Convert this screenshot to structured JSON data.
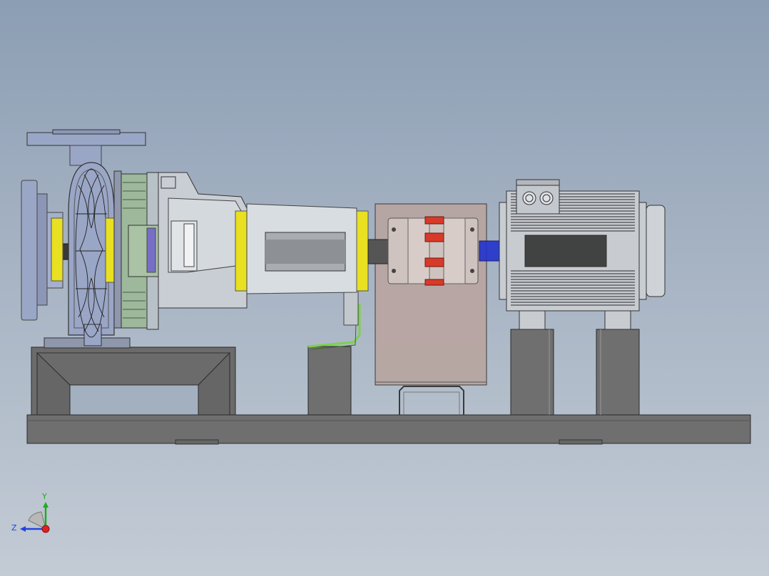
{
  "viewport": {
    "background_top": "#8c9eb4",
    "background_bottom": "#c3cbd5"
  },
  "model": {
    "components": [
      "pump-casing",
      "suction-flange",
      "discharge-flange",
      "impeller",
      "bearing-bracket",
      "pump-shaft",
      "coupling-guard",
      "jaw-coupling",
      "electric-motor",
      "motor-terminal-box",
      "motor-shaft",
      "motor-feet",
      "pump-support",
      "base-frame"
    ]
  },
  "colors": {
    "steel_dark": "#6f6f6f",
    "pump_blue": "#9aa6c6",
    "seal_green": "#9db89a",
    "gasket_yellow": "#e8e020",
    "guard_brown": "#b8a6a2",
    "coupling_insert_red": "#d83a2a",
    "motor_shaft_blue": "#2233cc",
    "wire_green": "#7ed04a"
  },
  "triad": {
    "y_label": "Y",
    "z_label": "Z",
    "y_color": "#22aa22",
    "z_color": "#2244dd",
    "x_color": "#dd2222"
  }
}
